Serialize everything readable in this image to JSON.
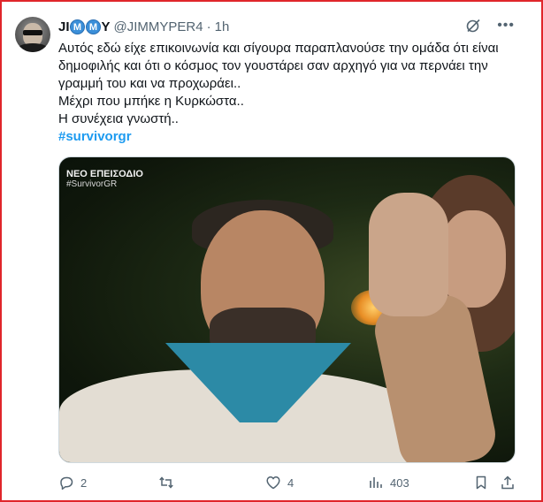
{
  "author": {
    "name_prefix": "JI",
    "name_badge_1": "M",
    "name_badge_2": "M",
    "name_suffix": "Y",
    "handle": "@JIMMYPER4",
    "separator": "·",
    "time": "1h"
  },
  "tweet": {
    "line1": "Αυτός εδώ είχε επικοινωνία και σίγουρα παραπλανούσε την ομάδα ότι είναι δημοφιλής και ότι ο κόσμος τον γουστάρει σαν αρχηγό για να περνάει την γραμμή του και να προχωράει..",
    "line2": "Μέχρι που μπήκε η Κυρκώστα..",
    "line3": "Η συνέχεια γνωστή..",
    "hashtag": "#survivorgr"
  },
  "media": {
    "overlay_title": "ΝΕΟ ΕΠΕΙΣΟΔΙΟ",
    "overlay_tag": "#SurvivorGR"
  },
  "actions": {
    "replies": "2",
    "retweets": "",
    "likes": "4",
    "views": "403"
  },
  "icons": {
    "header": [
      "grok-icon",
      "more-icon"
    ],
    "actions": [
      "reply-icon",
      "retweet-icon",
      "like-icon",
      "views-icon",
      "bookmark-icon",
      "share-icon"
    ]
  },
  "colors": {
    "link": "#1d9bf0",
    "muted": "#536471",
    "frame": "#e0262b"
  }
}
